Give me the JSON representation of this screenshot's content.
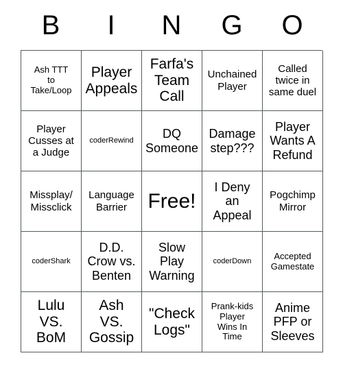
{
  "card": {
    "header_letters": [
      "B",
      "I",
      "N",
      "G",
      "O"
    ],
    "columns": 5,
    "rows": 5,
    "free_space_index": 12,
    "colors": {
      "background": "#ffffff",
      "text": "#000000",
      "grid_line": "#555a5e"
    },
    "cells": [
      {
        "text": "Ash TTT\nto\nTake/Loop",
        "size": "sm"
      },
      {
        "text": "Player\nAppeals",
        "size": "xl"
      },
      {
        "text": "Farfa's\nTeam\nCall",
        "size": "xl"
      },
      {
        "text": "Unchained\nPlayer",
        "size": "md"
      },
      {
        "text": "Called\ntwice in\nsame duel",
        "size": "md"
      },
      {
        "text": "Player\nCusses at\na Judge",
        "size": "md"
      },
      {
        "text": "coderRewind",
        "size": "xs"
      },
      {
        "text": "DQ\nSomeone",
        "size": "lg"
      },
      {
        "text": "Damage\nstep???",
        "size": "lg"
      },
      {
        "text": "Player\nWants A\nRefund",
        "size": "lg"
      },
      {
        "text": "Missplay/\nMissclick",
        "size": "md"
      },
      {
        "text": "Language\nBarrier",
        "size": "md"
      },
      {
        "text": "Free!",
        "size": "free"
      },
      {
        "text": "I Deny\nan\nAppeal",
        "size": "lg"
      },
      {
        "text": "Pogchimp\nMirror",
        "size": "md"
      },
      {
        "text": "coderShark",
        "size": "xs"
      },
      {
        "text": "D.D.\nCrow vs.\nBenten",
        "size": "lg"
      },
      {
        "text": "Slow\nPlay\nWarning",
        "size": "lg"
      },
      {
        "text": "coderDown",
        "size": "xs"
      },
      {
        "text": "Accepted\nGamestate",
        "size": "sm"
      },
      {
        "text": "Lulu\nVS.\nBoM",
        "size": "xl"
      },
      {
        "text": "Ash\nVS.\nGossip",
        "size": "xl"
      },
      {
        "text": "\"Check\nLogs\"",
        "size": "xl"
      },
      {
        "text": "Prank-kids\nPlayer\nWins In\nTime",
        "size": "sm"
      },
      {
        "text": "Anime\nPFP or\nSleeves",
        "size": "lg"
      }
    ]
  }
}
